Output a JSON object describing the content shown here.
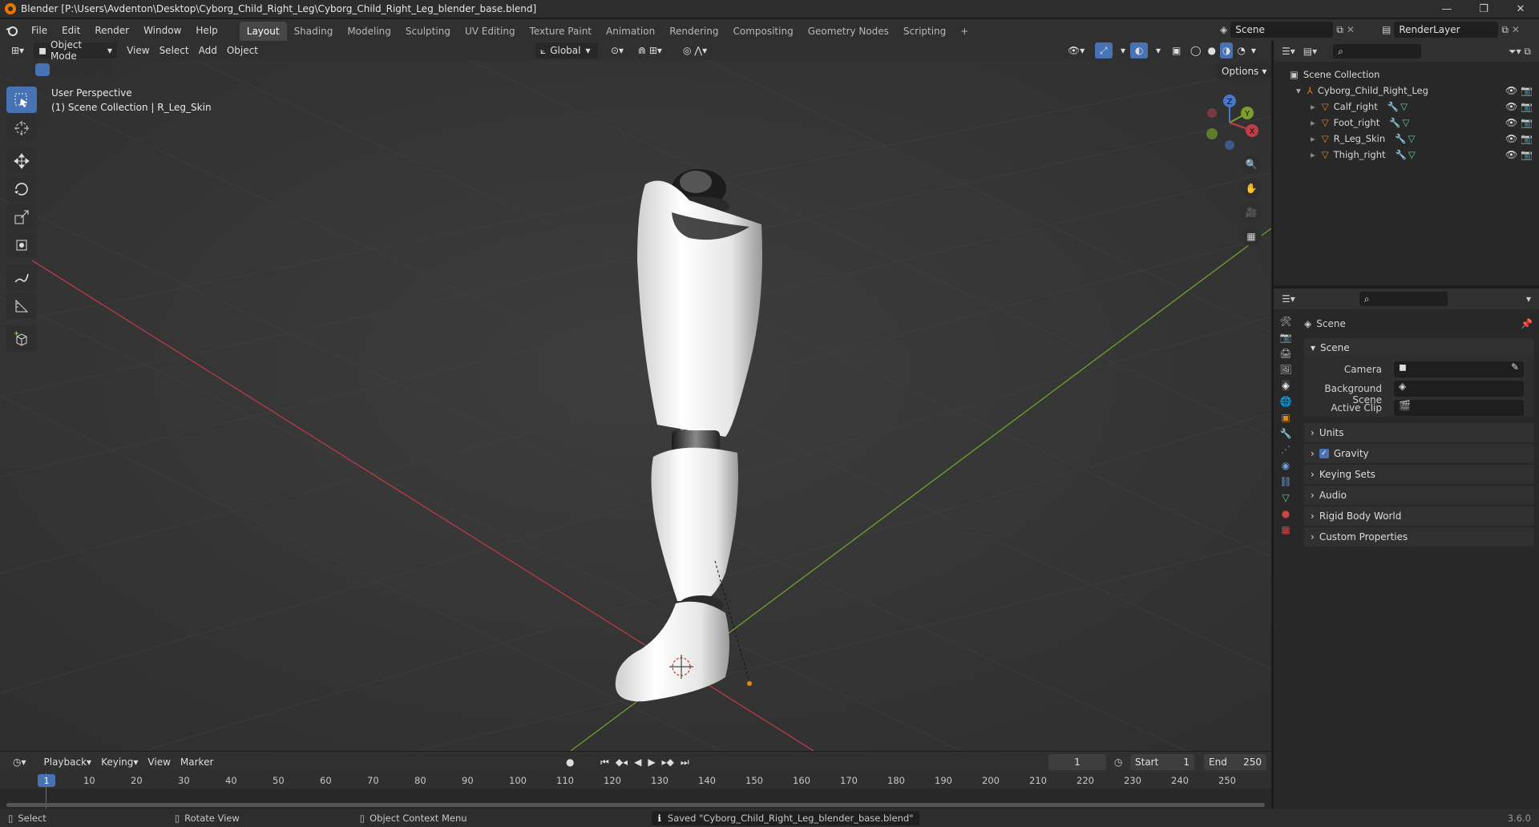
{
  "window": {
    "title": "Blender [P:\\Users\\Avdenton\\Desktop\\Cyborg_Child_Right_Leg\\Cyborg_Child_Right_Leg_blender_base.blend]",
    "controls": [
      "—",
      "❐",
      "✕"
    ]
  },
  "menus": [
    "File",
    "Edit",
    "Render",
    "Window",
    "Help"
  ],
  "workspaces": [
    "Layout",
    "Shading",
    "Modeling",
    "Sculpting",
    "UV Editing",
    "Texture Paint",
    "Animation",
    "Rendering",
    "Compositing",
    "Geometry Nodes",
    "Scripting"
  ],
  "active_workspace": "Layout",
  "scene_field": "Scene",
  "render_layer_field": "RenderLayer",
  "viewport_header": {
    "mode": "Object Mode",
    "menus": [
      "View",
      "Select",
      "Add",
      "Object"
    ],
    "orientation": "Global",
    "options": "Options"
  },
  "viewport": {
    "perspective": "User Perspective",
    "collection_info": "(1) Scene Collection | R_Leg_Skin",
    "gizmo_axes": [
      "Z",
      "Y",
      "X"
    ],
    "x_axis_color": "#b03a48",
    "y_axis_color": "#6a9a2e",
    "bg_color": "#393939"
  },
  "outliner": {
    "root": "Scene Collection",
    "collection": "Cyborg_Child_Right_Leg",
    "objects": [
      "Calf_right",
      "Foot_right",
      "R_Leg_Skin",
      "Thigh_right"
    ]
  },
  "properties": {
    "context_title": "Scene",
    "panel": "Scene",
    "camera_label": "Camera",
    "background_scene_label": "Background Scene",
    "active_clip_label": "Active Clip",
    "sections": [
      "Units",
      "Gravity",
      "Keying Sets",
      "Audio",
      "Rigid Body World",
      "Custom Properties"
    ],
    "gravity_checked": true
  },
  "timeline": {
    "menus": [
      "Playback",
      "Keying",
      "View",
      "Marker"
    ],
    "current_frame": "1",
    "start_label": "Start",
    "start": "1",
    "end_label": "End",
    "end": "250",
    "ruler_current": "1",
    "ticks": [
      "10",
      "20",
      "30",
      "40",
      "50",
      "60",
      "70",
      "80",
      "90",
      "100",
      "110",
      "120",
      "130",
      "140",
      "150",
      "160",
      "170",
      "180",
      "190",
      "200",
      "210",
      "220",
      "230",
      "240",
      "250"
    ]
  },
  "status": {
    "select": "Select",
    "rotate": "Rotate View",
    "context_menu": "Object Context Menu",
    "message": "Saved \"Cyborg_Child_Right_Leg_blender_base.blend\"",
    "version": "3.6.0"
  }
}
